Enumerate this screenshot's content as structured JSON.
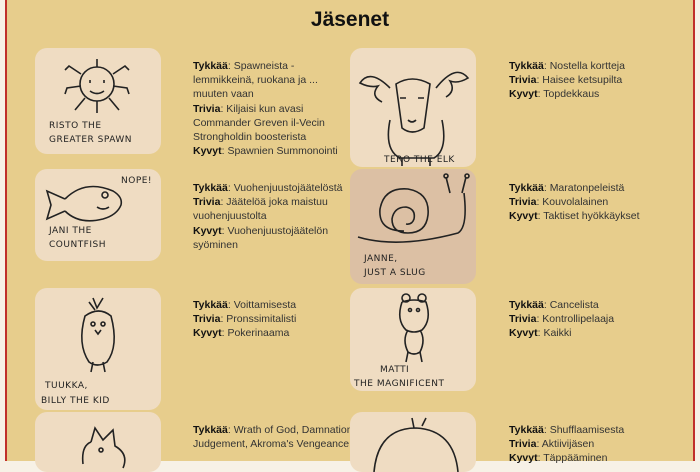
{
  "page": {
    "title": "Jäsenet"
  },
  "labels": {
    "likes": "Tykkää",
    "trivia": "Trivia",
    "skills": "Kyvyt"
  },
  "members": [
    {
      "drawing_caption": [
        "RISTO THE",
        "GREATER SPAWN"
      ],
      "likes": "Spawneista - lemmikkeinä, ruokana ja ... muuten vaan",
      "trivia": "Kiljaisi kun avasi Commander Greven il-Vecin Strongholdin boosterista",
      "skills": "Spawnien Summonointi"
    },
    {
      "drawing_caption": [
        "TERO THE ELK"
      ],
      "likes": "Nostella kortteja",
      "trivia": "Haisee ketsupilta",
      "skills": "Topdekkaus"
    },
    {
      "drawing_caption": [
        "NOPE!",
        "JANI THE",
        "COUNTFISH"
      ],
      "likes": "Vuohenjuustojäätelöstä",
      "trivia": "Jäätelöä joka maistuu vuohenjuustolta",
      "skills": "Vuohenjuustojäätelön syöminen"
    },
    {
      "drawing_caption": [
        "JANNE,",
        "JUST A SLUG"
      ],
      "likes": "Maratonpeleistä",
      "trivia": "Kouvolalainen",
      "skills": "Taktiset hyökkäykset"
    },
    {
      "drawing_caption": [
        "TUUKKA,",
        "BILLY THE KID"
      ],
      "likes": "Voittamisesta",
      "trivia": "Pronssimitalisti",
      "skills": "Pokerinaama"
    },
    {
      "drawing_caption": [
        "MATTI",
        "THE MAGNIFICENT"
      ],
      "likes": "Cancelista",
      "trivia": "Kontrollipelaaja",
      "skills": "Kaikki"
    },
    {
      "drawing_caption": [],
      "likes": "Wrath of God, Damnation, Judgement, Akroma's Vengeance",
      "trivia": "",
      "skills": ""
    },
    {
      "drawing_caption": [],
      "likes": "Shufflaamisesta",
      "trivia": "Aktiivijäsen",
      "skills": "Täppääminen"
    }
  ]
}
